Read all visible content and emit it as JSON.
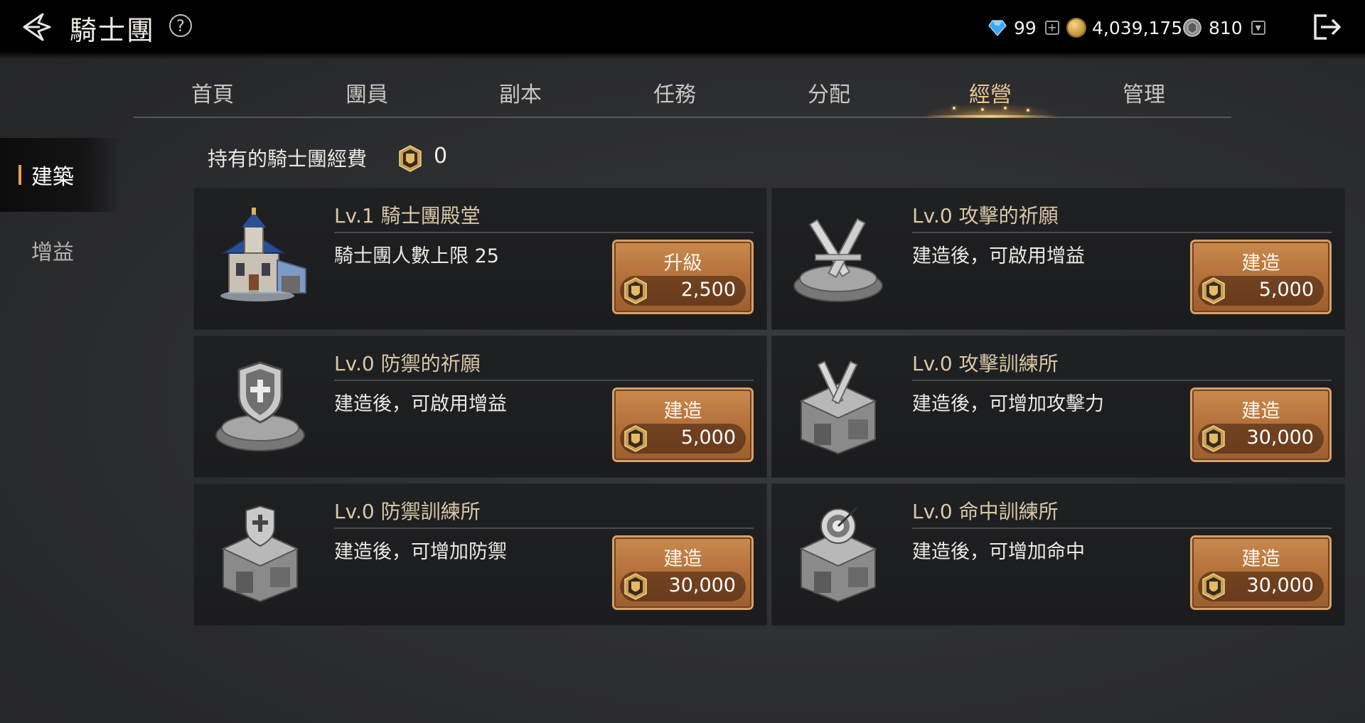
{
  "header": {
    "title": "騎士團",
    "help": "?",
    "currencies": [
      {
        "name": "diamond",
        "value": "99"
      },
      {
        "name": "gold",
        "value": "4,039,175"
      },
      {
        "name": "silver",
        "value": "810"
      }
    ]
  },
  "tabs": [
    {
      "label": "首頁"
    },
    {
      "label": "團員"
    },
    {
      "label": "副本"
    },
    {
      "label": "任務"
    },
    {
      "label": "分配"
    },
    {
      "label": "經營"
    },
    {
      "label": "管理"
    }
  ],
  "active_tab": "經營",
  "sidebar": {
    "items": [
      {
        "label": "建築"
      },
      {
        "label": "增益"
      }
    ],
    "active": "建築"
  },
  "funds": {
    "label": "持有的騎士團經費",
    "value": "0"
  },
  "buildings": [
    {
      "name": "Lv.1  騎士團殿堂",
      "desc": "騎士團人數上限 25",
      "button": "升級",
      "cost": "2,500",
      "icon": "chapel-icon"
    },
    {
      "name": "Lv.0  攻擊的祈願",
      "desc": "建造後，可啟用增益",
      "button": "建造",
      "cost": "5,000",
      "icon": "crossed-swords-altar-icon"
    },
    {
      "name": "Lv.0  防禦的祈願",
      "desc": "建造後，可啟用增益",
      "button": "建造",
      "cost": "5,000",
      "icon": "shield-altar-icon"
    },
    {
      "name": "Lv.0  攻擊訓練所",
      "desc": "建造後，可增加攻擊力",
      "button": "建造",
      "cost": "30,000",
      "icon": "attack-training-icon"
    },
    {
      "name": "Lv.0  防禦訓練所",
      "desc": "建造後，可增加防禦",
      "button": "建造",
      "cost": "30,000",
      "icon": "defense-training-icon"
    },
    {
      "name": "Lv.0  命中訓練所",
      "desc": "建造後，可增加命中",
      "button": "建造",
      "cost": "30,000",
      "icon": "accuracy-training-icon"
    }
  ],
  "colors": {
    "accent": "#e9c98a",
    "button": "#b4713a",
    "sidebar_marker": "#e8a04a"
  }
}
